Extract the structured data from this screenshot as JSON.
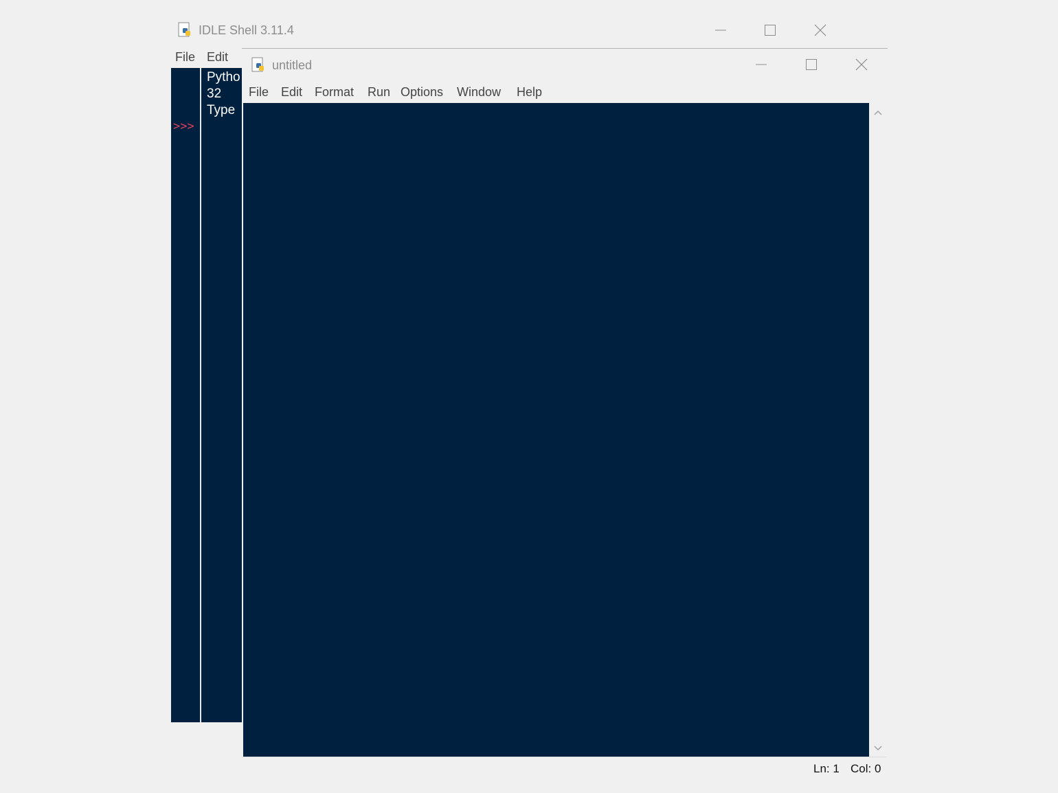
{
  "shell": {
    "title": "IDLE Shell 3.11.4",
    "menu": [
      "File",
      "Edit"
    ],
    "text_lines": [
      "Pytho",
      "32",
      "Type"
    ],
    "prompt": ">>>"
  },
  "editor": {
    "title": "untitled",
    "menu": [
      "File",
      "Edit",
      "Format",
      "Run",
      "Options",
      "Window",
      "Help"
    ],
    "status": {
      "line": "Ln: 1",
      "col": "Col: 0"
    }
  },
  "colors": {
    "editor_background": "#002040",
    "prompt": "#e0405a",
    "chrome": "#f0f0f0"
  }
}
